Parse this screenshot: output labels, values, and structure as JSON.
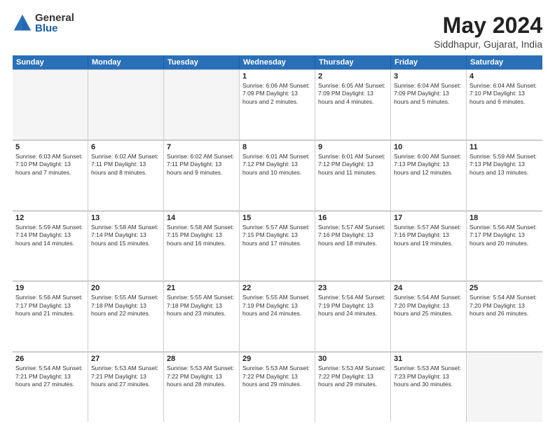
{
  "logo": {
    "general": "General",
    "blue": "Blue"
  },
  "title": "May 2024",
  "location": "Siddhapur, Gujarat, India",
  "header_days": [
    "Sunday",
    "Monday",
    "Tuesday",
    "Wednesday",
    "Thursday",
    "Friday",
    "Saturday"
  ],
  "weeks": [
    [
      {
        "day": "",
        "info": ""
      },
      {
        "day": "",
        "info": ""
      },
      {
        "day": "",
        "info": ""
      },
      {
        "day": "1",
        "info": "Sunrise: 6:06 AM\nSunset: 7:09 PM\nDaylight: 13 hours and 2 minutes."
      },
      {
        "day": "2",
        "info": "Sunrise: 6:05 AM\nSunset: 7:09 PM\nDaylight: 13 hours and 4 minutes."
      },
      {
        "day": "3",
        "info": "Sunrise: 6:04 AM\nSunset: 7:09 PM\nDaylight: 13 hours and 5 minutes."
      },
      {
        "day": "4",
        "info": "Sunrise: 6:04 AM\nSunset: 7:10 PM\nDaylight: 13 hours and 6 minutes."
      }
    ],
    [
      {
        "day": "5",
        "info": "Sunrise: 6:03 AM\nSunset: 7:10 PM\nDaylight: 13 hours and 7 minutes."
      },
      {
        "day": "6",
        "info": "Sunrise: 6:02 AM\nSunset: 7:11 PM\nDaylight: 13 hours and 8 minutes."
      },
      {
        "day": "7",
        "info": "Sunrise: 6:02 AM\nSunset: 7:11 PM\nDaylight: 13 hours and 9 minutes."
      },
      {
        "day": "8",
        "info": "Sunrise: 6:01 AM\nSunset: 7:12 PM\nDaylight: 13 hours and 10 minutes."
      },
      {
        "day": "9",
        "info": "Sunrise: 6:01 AM\nSunset: 7:12 PM\nDaylight: 13 hours and 11 minutes."
      },
      {
        "day": "10",
        "info": "Sunrise: 6:00 AM\nSunset: 7:13 PM\nDaylight: 13 hours and 12 minutes."
      },
      {
        "day": "11",
        "info": "Sunrise: 5:59 AM\nSunset: 7:13 PM\nDaylight: 13 hours and 13 minutes."
      }
    ],
    [
      {
        "day": "12",
        "info": "Sunrise: 5:59 AM\nSunset: 7:14 PM\nDaylight: 13 hours and 14 minutes."
      },
      {
        "day": "13",
        "info": "Sunrise: 5:58 AM\nSunset: 7:14 PM\nDaylight: 13 hours and 15 minutes."
      },
      {
        "day": "14",
        "info": "Sunrise: 5:58 AM\nSunset: 7:15 PM\nDaylight: 13 hours and 16 minutes."
      },
      {
        "day": "15",
        "info": "Sunrise: 5:57 AM\nSunset: 7:15 PM\nDaylight: 13 hours and 17 minutes."
      },
      {
        "day": "16",
        "info": "Sunrise: 5:57 AM\nSunset: 7:16 PM\nDaylight: 13 hours and 18 minutes."
      },
      {
        "day": "17",
        "info": "Sunrise: 5:57 AM\nSunset: 7:16 PM\nDaylight: 13 hours and 19 minutes."
      },
      {
        "day": "18",
        "info": "Sunrise: 5:56 AM\nSunset: 7:17 PM\nDaylight: 13 hours and 20 minutes."
      }
    ],
    [
      {
        "day": "19",
        "info": "Sunrise: 5:56 AM\nSunset: 7:17 PM\nDaylight: 13 hours and 21 minutes."
      },
      {
        "day": "20",
        "info": "Sunrise: 5:55 AM\nSunset: 7:18 PM\nDaylight: 13 hours and 22 minutes."
      },
      {
        "day": "21",
        "info": "Sunrise: 5:55 AM\nSunset: 7:18 PM\nDaylight: 13 hours and 23 minutes."
      },
      {
        "day": "22",
        "info": "Sunrise: 5:55 AM\nSunset: 7:19 PM\nDaylight: 13 hours and 24 minutes."
      },
      {
        "day": "23",
        "info": "Sunrise: 5:54 AM\nSunset: 7:19 PM\nDaylight: 13 hours and 24 minutes."
      },
      {
        "day": "24",
        "info": "Sunrise: 5:54 AM\nSunset: 7:20 PM\nDaylight: 13 hours and 25 minutes."
      },
      {
        "day": "25",
        "info": "Sunrise: 5:54 AM\nSunset: 7:20 PM\nDaylight: 13 hours and 26 minutes."
      }
    ],
    [
      {
        "day": "26",
        "info": "Sunrise: 5:54 AM\nSunset: 7:21 PM\nDaylight: 13 hours and 27 minutes."
      },
      {
        "day": "27",
        "info": "Sunrise: 5:53 AM\nSunset: 7:21 PM\nDaylight: 13 hours and 27 minutes."
      },
      {
        "day": "28",
        "info": "Sunrise: 5:53 AM\nSunset: 7:22 PM\nDaylight: 13 hours and 28 minutes."
      },
      {
        "day": "29",
        "info": "Sunrise: 5:53 AM\nSunset: 7:22 PM\nDaylight: 13 hours and 29 minutes."
      },
      {
        "day": "30",
        "info": "Sunrise: 5:53 AM\nSunset: 7:22 PM\nDaylight: 13 hours and 29 minutes."
      },
      {
        "day": "31",
        "info": "Sunrise: 5:53 AM\nSunset: 7:23 PM\nDaylight: 13 hours and 30 minutes."
      },
      {
        "day": "",
        "info": ""
      }
    ]
  ]
}
